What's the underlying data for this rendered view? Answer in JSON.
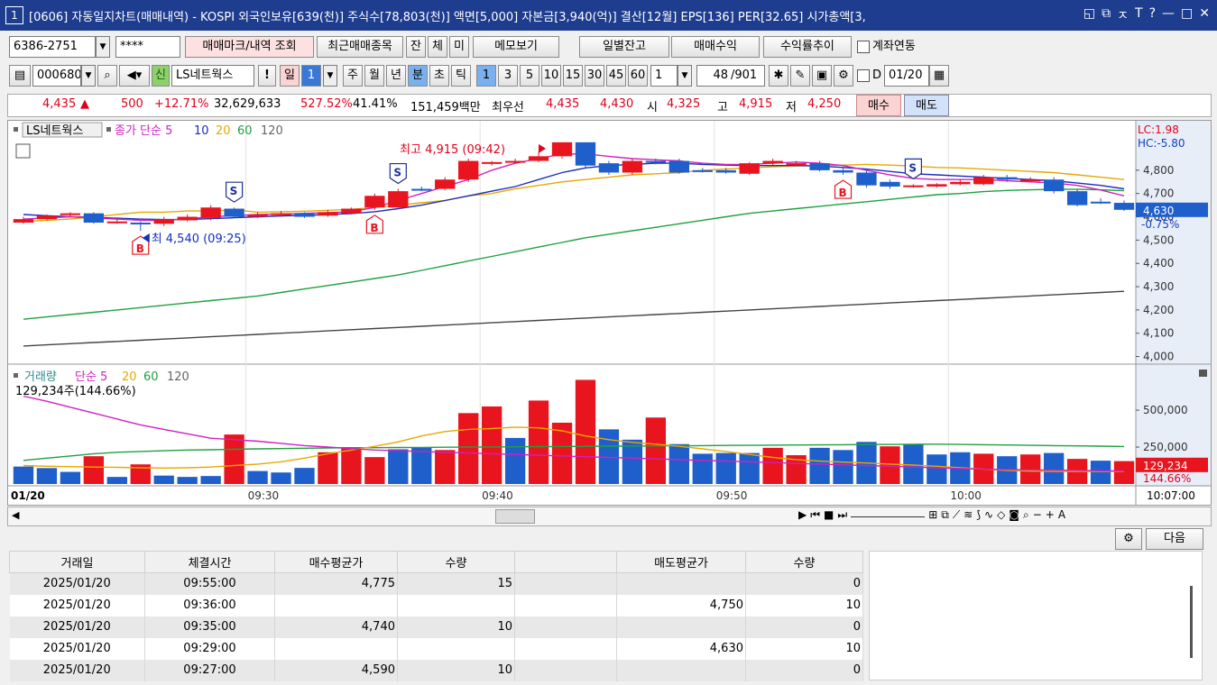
{
  "title": {
    "number": "1",
    "text": "[0606] 자동일지차트(매매내역) - KOSPI 외국인보유[639(천)] 주식수[78,803(천)] 액면[5,000] 자본금[3,940(억)] 결산[12월] EPS[136] PER[32.65] 시가총액[3,",
    "controls": [
      "◱",
      "⧉",
      "ㅈ",
      "T",
      "?",
      "—",
      "□",
      "✕"
    ]
  },
  "toolbar1": {
    "account": "6386-2751",
    "password": "****",
    "btn_trade_mark": "매매마크/내역 조회",
    "btn_recent": "최근매매종목",
    "btn_jan": "잔",
    "btn_che": "체",
    "btn_mi": "미",
    "btn_memo": "메모보기",
    "btn_daily_balance": "일별잔고",
    "btn_profit": "매매수익",
    "btn_return": "수익률추이",
    "link_label": "계좌연동"
  },
  "toolbar2": {
    "code": "000680",
    "badge": "신",
    "stock_name": "LS네트웍스",
    "exclaim": "!",
    "period_day": "일",
    "period_num": "1",
    "period_week": "주",
    "period_month": "월",
    "period_year": "년",
    "period_min": "분",
    "period_sec": "초",
    "period_tick": "틱",
    "intervals": [
      "1",
      "3",
      "5",
      "10",
      "15",
      "30",
      "45",
      "60"
    ],
    "count": "1",
    "range": "48",
    "range_total": "/901",
    "d_label": "D",
    "date": "01/20"
  },
  "quote": {
    "price": "4,435",
    "change": "500",
    "rate": "+12.71%",
    "volume": "32,629,633",
    "vol_rate": "527.52%",
    "turnover": "41.41%",
    "amount": "151,459백만",
    "best_label": "최우선",
    "ask": "4,435",
    "bid": "4,430",
    "open_label": "시",
    "open": "4,325",
    "high_label": "고",
    "high": "4,915",
    "low_label": "저",
    "low": "4,250",
    "buy_btn": "매수",
    "sell_btn": "매도"
  },
  "price_legend": {
    "name": "LS네트웍스",
    "ma_label": "종가 단순 5",
    "p10": "10",
    "p20": "20",
    "p60": "60",
    "p120": "120"
  },
  "price_annotations": {
    "high": "최고 4,915 (09:42)",
    "low": "4,540 (09:25)",
    "low_prefix": "최",
    "lc": "LC:1.98",
    "hc": "HC:-5.80",
    "current": "4,630",
    "current_pct": "-0.75%"
  },
  "volume_legend": {
    "name": "거래량",
    "ma_label": "단순 5",
    "p20": "20",
    "p60": "60",
    "p120": "120",
    "value": "129,234주(144.66%)",
    "current": "129,234",
    "current_pct": "144.66%"
  },
  "xaxis": {
    "left": "01/20",
    "right": "10:07:00"
  },
  "colors": {
    "up": "#e8141e",
    "down": "#1f5fcc",
    "ma5": "#d020c0",
    "ma10": "#1a2eb8",
    "ma20": "#e8a800",
    "ma60": "#20a040",
    "ma120": "#444444"
  },
  "chart_data": {
    "type": "candlestick",
    "x": [
      "09:20",
      "09:21",
      "09:22",
      "09:23",
      "09:24",
      "09:25",
      "09:26",
      "09:27",
      "09:28",
      "09:29",
      "09:30",
      "09:31",
      "09:32",
      "09:33",
      "09:34",
      "09:35",
      "09:36",
      "09:37",
      "09:38",
      "09:39",
      "09:40",
      "09:41",
      "09:42",
      "09:43",
      "09:44",
      "09:45",
      "09:46",
      "09:47",
      "09:48",
      "09:49",
      "09:50",
      "09:51",
      "09:52",
      "09:53",
      "09:54",
      "09:55",
      "09:56",
      "09:57",
      "09:58",
      "09:59",
      "10:00",
      "10:01",
      "10:02",
      "10:03",
      "10:04",
      "10:05",
      "10:06",
      "10:07"
    ],
    "x_ticks": [
      "09:30",
      "09:40",
      "09:50",
      "10:00"
    ],
    "ohlc": [
      [
        4575,
        4590,
        4570,
        4600
      ],
      [
        4590,
        4605,
        4585,
        4610
      ],
      [
        4610,
        4615,
        4600,
        4620
      ],
      [
        4615,
        4575,
        4570,
        4620
      ],
      [
        4580,
        4580,
        4570,
        4590
      ],
      [
        4575,
        4570,
        4540,
        4580
      ],
      [
        4570,
        4590,
        4560,
        4600
      ],
      [
        4585,
        4600,
        4580,
        4610
      ],
      [
        4595,
        4640,
        4585,
        4650
      ],
      [
        4635,
        4600,
        4595,
        4640
      ],
      [
        4600,
        4610,
        4595,
        4620
      ],
      [
        4610,
        4615,
        4600,
        4625
      ],
      [
        4615,
        4600,
        4595,
        4620
      ],
      [
        4605,
        4620,
        4600,
        4630
      ],
      [
        4615,
        4635,
        4610,
        4640
      ],
      [
        4640,
        4690,
        4630,
        4700
      ],
      [
        4640,
        4710,
        4640,
        4720
      ],
      [
        4720,
        4715,
        4710,
        4730
      ],
      [
        4720,
        4760,
        4715,
        4770
      ],
      [
        4760,
        4840,
        4750,
        4850
      ],
      [
        4830,
        4835,
        4820,
        4840
      ],
      [
        4835,
        4840,
        4830,
        4850
      ],
      [
        4840,
        4860,
        4835,
        4880
      ],
      [
        4860,
        4920,
        4850,
        4920
      ],
      [
        4920,
        4820,
        4810,
        4920
      ],
      [
        4830,
        4790,
        4780,
        4840
      ],
      [
        4790,
        4840,
        4780,
        4850
      ],
      [
        4840,
        4835,
        4825,
        4850
      ],
      [
        4840,
        4790,
        4785,
        4850
      ],
      [
        4800,
        4795,
        4790,
        4810
      ],
      [
        4800,
        4790,
        4785,
        4810
      ],
      [
        4785,
        4830,
        4780,
        4835
      ],
      [
        4830,
        4840,
        4820,
        4850
      ],
      [
        4830,
        4830,
        4820,
        4840
      ],
      [
        4830,
        4800,
        4795,
        4840
      ],
      [
        4800,
        4790,
        4780,
        4810
      ],
      [
        4790,
        4735,
        4725,
        4800
      ],
      [
        4750,
        4730,
        4720,
        4760
      ],
      [
        4730,
        4735,
        4725,
        4740
      ],
      [
        4730,
        4740,
        4725,
        4745
      ],
      [
        4740,
        4750,
        4735,
        4760
      ],
      [
        4740,
        4770,
        4735,
        4780
      ],
      [
        4770,
        4760,
        4750,
        4780
      ],
      [
        4760,
        4760,
        4750,
        4770
      ],
      [
        4760,
        4710,
        4700,
        4770
      ],
      [
        4710,
        4650,
        4645,
        4720
      ],
      [
        4665,
        4660,
        4655,
        4680
      ],
      [
        4660,
        4630,
        4625,
        4670
      ]
    ],
    "volume": [
      118000,
      108000,
      82000,
      188000,
      48000,
      133000,
      57000,
      48000,
      54000,
      335000,
      88000,
      78000,
      109000,
      215000,
      250000,
      182000,
      235000,
      250000,
      230000,
      480000,
      525000,
      312000,
      565000,
      415000,
      705000,
      370000,
      300000,
      450000,
      270000,
      205000,
      210000,
      210000,
      245000,
      195000,
      245000,
      230000,
      285000,
      255000,
      270000,
      200000,
      215000,
      205000,
      188000,
      200000,
      210000,
      170000,
      158000,
      155000
    ],
    "volume_dir": [
      0,
      0,
      0,
      1,
      0,
      1,
      0,
      0,
      0,
      1,
      0,
      0,
      0,
      1,
      1,
      1,
      0,
      0,
      1,
      1,
      1,
      0,
      1,
      1,
      1,
      0,
      0,
      1,
      0,
      0,
      0,
      0,
      1,
      1,
      0,
      0,
      0,
      1,
      0,
      0,
      0,
      1,
      0,
      1,
      0,
      1,
      0,
      1
    ],
    "trade_marks": [
      {
        "type": "B",
        "time": "09:25"
      },
      {
        "type": "S",
        "time": "09:29"
      },
      {
        "type": "B",
        "time": "09:35"
      },
      {
        "type": "S",
        "time": "09:36"
      },
      {
        "type": "B",
        "time": "09:55"
      },
      {
        "type": "S",
        "time": "09:58"
      }
    ],
    "y_ticks": [
      "4,800",
      "4,700",
      "4,600",
      "4,500",
      "4,400",
      "4,300",
      "4,200",
      "4,100",
      "4,000"
    ],
    "y_range": [
      3975,
      4935
    ],
    "vol_ticks": [
      "500,000",
      "250,000"
    ],
    "vol_range": [
      0,
      720000
    ],
    "ma5": [
      4590,
      4595,
      4600,
      4595,
      4590,
      4585,
      4585,
      4590,
      4600,
      4605,
      4610,
      4612,
      4615,
      4618,
      4622,
      4640,
      4670,
      4700,
      4730,
      4760,
      4800,
      4830,
      4850,
      4870,
      4870,
      4860,
      4850,
      4845,
      4840,
      4830,
      4825,
      4825,
      4830,
      4835,
      4830,
      4820,
      4800,
      4780,
      4765,
      4760,
      4760,
      4760,
      4755,
      4750,
      4745,
      4735,
      4715,
      4690
    ],
    "ma10": [
      4610,
      4605,
      4600,
      4598,
      4594,
      4590,
      4588,
      4588,
      4592,
      4596,
      4600,
      4604,
      4606,
      4610,
      4614,
      4622,
      4635,
      4650,
      4670,
      4690,
      4710,
      4730,
      4760,
      4790,
      4810,
      4820,
      4825,
      4830,
      4830,
      4825,
      4822,
      4820,
      4820,
      4820,
      4818,
      4812,
      4805,
      4795,
      4785,
      4780,
      4775,
      4770,
      4765,
      4760,
      4755,
      4745,
      4735,
      4720
    ],
    "ma20": [
      4580,
      4585,
      4590,
      4600,
      4610,
      4620,
      4620,
      4625,
      4625,
      4630,
      4620,
      4622,
      4624,
      4628,
      4632,
      4640,
      4650,
      4660,
      4670,
      4690,
      4700,
      4720,
      4735,
      4750,
      4760,
      4770,
      4780,
      4785,
      4790,
      4800,
      4805,
      4810,
      4815,
      4818,
      4820,
      4822,
      4825,
      4822,
      4818,
      4812,
      4810,
      4805,
      4800,
      4795,
      4790,
      4780,
      4770,
      4760
    ],
    "ma60": [
      4160,
      4170,
      4180,
      4190,
      4200,
      4210,
      4220,
      4230,
      4240,
      4250,
      4260,
      4275,
      4290,
      4305,
      4320,
      4335,
      4350,
      4370,
      4390,
      4410,
      4430,
      4450,
      4470,
      4490,
      4510,
      4525,
      4540,
      4555,
      4570,
      4585,
      4600,
      4615,
      4625,
      4635,
      4645,
      4655,
      4665,
      4675,
      4685,
      4695,
      4700,
      4708,
      4713,
      4716,
      4718,
      4718,
      4716,
      4712
    ],
    "ma120": [
      4045,
      4050,
      4055,
      4060,
      4065,
      4070,
      4075,
      4080,
      4085,
      4090,
      4095,
      4100,
      4105,
      4110,
      4115,
      4120,
      4125,
      4130,
      4135,
      4140,
      4145,
      4150,
      4155,
      4160,
      4165,
      4170,
      4175,
      4180,
      4185,
      4190,
      4195,
      4200,
      4205,
      4210,
      4215,
      4220,
      4225,
      4230,
      4235,
      4240,
      4245,
      4250,
      4255,
      4260,
      4265,
      4270,
      4275,
      4280
    ],
    "vol_ma5": [
      595000,
      560000,
      520000,
      480000,
      440000,
      400000,
      370000,
      340000,
      310000,
      300000,
      290000,
      275000,
      260000,
      250000,
      240000,
      230000,
      225000,
      220000,
      215000,
      210000,
      205000,
      200000,
      195000,
      190000,
      185000,
      180000,
      175000,
      170000,
      165000,
      160000,
      155000,
      150000,
      145000,
      140000,
      135000,
      130000,
      125000,
      120000,
      115000,
      110000,
      105000,
      100000,
      98000,
      96000,
      94000,
      92000,
      90000,
      88000
    ],
    "vol_ma20": [
      125000,
      120000,
      118000,
      115000,
      113000,
      110000,
      108000,
      110000,
      115000,
      125000,
      135000,
      150000,
      175000,
      205000,
      230000,
      255000,
      285000,
      325000,
      355000,
      370000,
      375000,
      385000,
      380000,
      360000,
      325000,
      300000,
      282000,
      270000,
      255000,
      238000,
      220000,
      200000,
      180000,
      165000,
      155000,
      148000,
      142000,
      135000,
      128000,
      120000,
      110000,
      100000,
      92000,
      87000,
      85000,
      85000,
      85000,
      85000
    ],
    "vol_ma60": [
      160000,
      175000,
      190000,
      205000,
      215000,
      220000,
      225000,
      230000,
      232000,
      235000,
      238000,
      240000,
      242000,
      244000,
      245000,
      246000,
      247000,
      248000,
      249000,
      250000,
      251000,
      252000,
      253000,
      254000,
      255000,
      256000,
      257000,
      258000,
      259000,
      260000,
      261000,
      262000,
      263000,
      264000,
      265000,
      266000,
      267000,
      268000,
      269000,
      270000,
      268000,
      266000,
      264000,
      262000,
      260000,
      258000,
      256000,
      254000
    ]
  },
  "bottom": {
    "next_btn": "다음",
    "columns": [
      "거래일",
      "체결시간",
      "매수평균가",
      "수량",
      "",
      "매도평균가",
      "수량"
    ],
    "rows": [
      [
        "2025/01/20",
        "09:55:00",
        "4,775",
        "15",
        "",
        "",
        "0"
      ],
      [
        "2025/01/20",
        "09:36:00",
        "",
        "",
        "",
        "4,750",
        "10"
      ],
      [
        "2025/01/20",
        "09:35:00",
        "4,740",
        "10",
        "",
        "",
        "0"
      ],
      [
        "2025/01/20",
        "09:29:00",
        "",
        "",
        "",
        "4,630",
        "10"
      ],
      [
        "2025/01/20",
        "09:27:00",
        "4,590",
        "10",
        "",
        "",
        "0"
      ]
    ]
  }
}
